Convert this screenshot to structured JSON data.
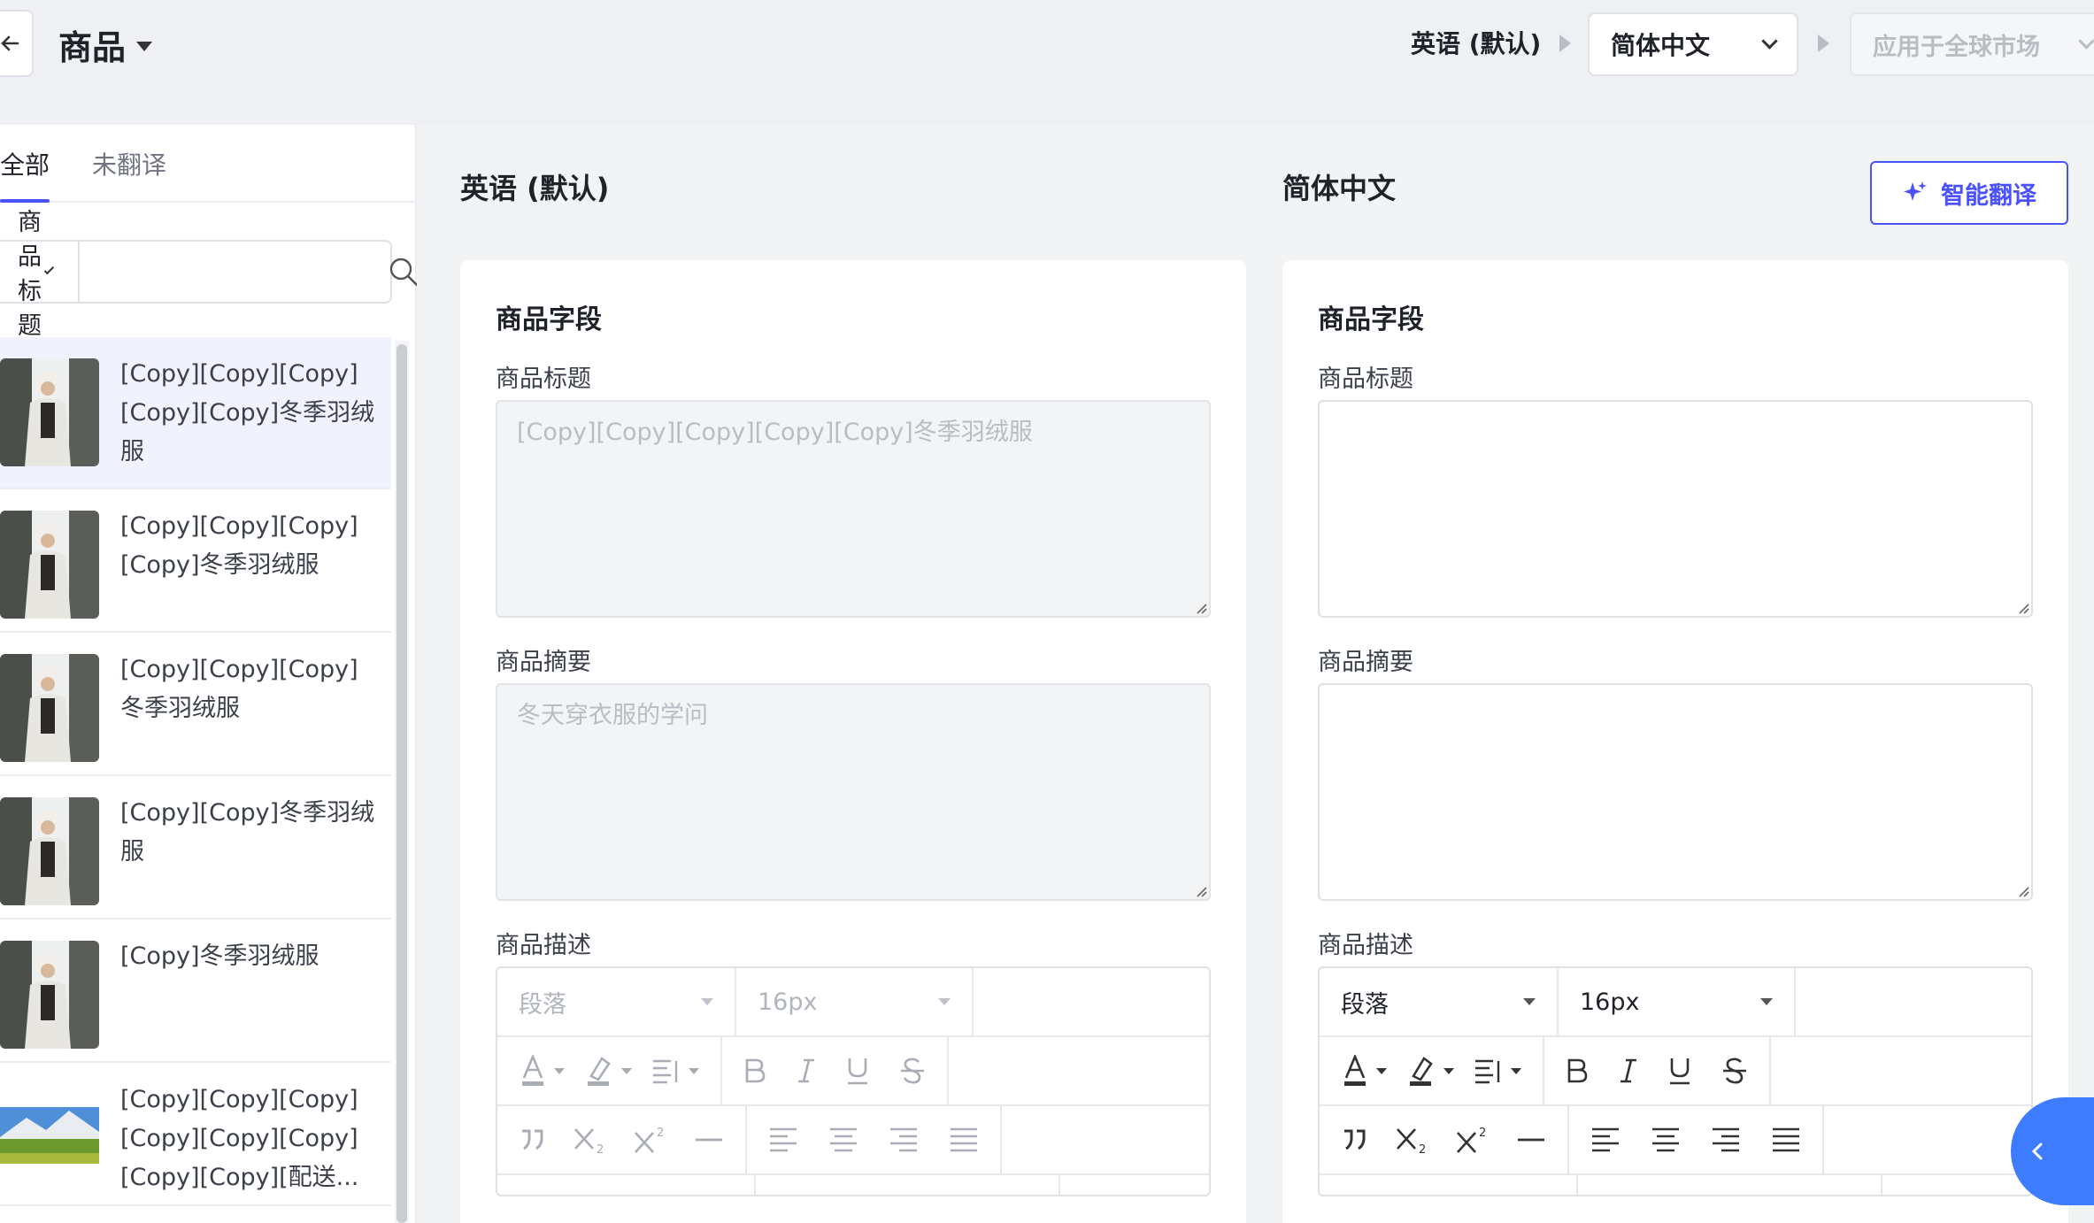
{
  "header": {
    "title": "商品",
    "source_language": "英语 (默认)",
    "target_language": "简体中文",
    "market": "应用于全球市场"
  },
  "left": {
    "tabs": [
      {
        "label": "全部",
        "active": true
      },
      {
        "label": "未翻译",
        "active": false
      }
    ],
    "filter": {
      "field": "商品标题",
      "value": ""
    },
    "products": [
      {
        "name": "[Copy][Copy][Copy][Copy][Copy]冬季羽绒服",
        "thumb": "woman-coat-icon",
        "selected": true
      },
      {
        "name": "[Copy][Copy][Copy][Copy]冬季羽绒服",
        "thumb": "woman-coat-icon",
        "selected": false
      },
      {
        "name": "[Copy][Copy][Copy]冬季羽绒服",
        "thumb": "woman-coat-icon",
        "selected": false
      },
      {
        "name": "[Copy][Copy]冬季羽绒服",
        "thumb": "woman-coat-icon",
        "selected": false
      },
      {
        "name": "[Copy]冬季羽绒服",
        "thumb": "woman-coat-icon",
        "selected": false
      },
      {
        "name": "[Copy][Copy][Copy][Copy][Copy][Copy][Copy][Copy][配送...",
        "thumb": "landscape-icon",
        "selected": false
      }
    ]
  },
  "source_column": {
    "heading": "英语 (默认)",
    "section_title": "商品字段",
    "title_label": "商品标题",
    "title_value": "[Copy][Copy][Copy][Copy][Copy]冬季羽绒服",
    "summary_label": "商品摘要",
    "summary_value": "冬天穿衣服的学问",
    "description_label": "商品描述",
    "paragraph_style": "段落",
    "font_size": "16px"
  },
  "target_column": {
    "heading": "简体中文",
    "smart_translate_label": "智能翻译",
    "section_title": "商品字段",
    "title_label": "商品标题",
    "title_value": "",
    "summary_label": "商品摘要",
    "summary_value": "",
    "description_label": "商品描述",
    "paragraph_style": "段落",
    "font_size": "16px"
  },
  "colors": {
    "accent": "#4a51ff",
    "float_button": "#3d7bff",
    "selected_row": "#f0f3fd"
  }
}
